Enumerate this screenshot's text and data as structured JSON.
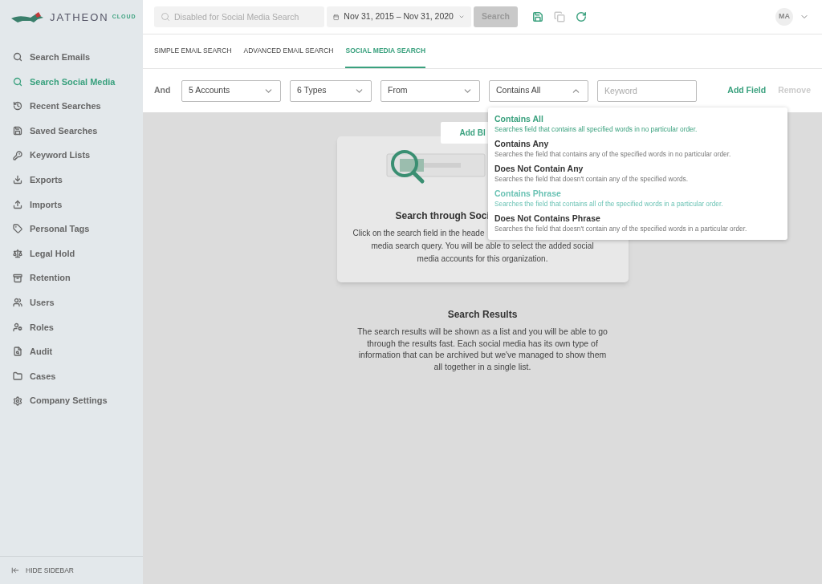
{
  "logo": {
    "name": "JATHEON",
    "suffix": "CLOUD"
  },
  "sidebar": {
    "items": [
      {
        "label": "Search Emails",
        "selected": false
      },
      {
        "label": "Search Social Media",
        "selected": true
      },
      {
        "label": "Recent Searches",
        "selected": false
      },
      {
        "label": "Saved Searches",
        "selected": false
      },
      {
        "label": "Keyword Lists",
        "selected": false
      },
      {
        "label": "Exports",
        "selected": false
      },
      {
        "label": "Imports",
        "selected": false
      },
      {
        "label": "Personal Tags",
        "selected": false
      },
      {
        "label": "Legal Hold",
        "selected": false
      },
      {
        "label": "Retention",
        "selected": false
      },
      {
        "label": "Users",
        "selected": false
      },
      {
        "label": "Roles",
        "selected": false
      },
      {
        "label": "Audit",
        "selected": false
      },
      {
        "label": "Cases",
        "selected": false
      },
      {
        "label": "Company Settings",
        "selected": false
      }
    ],
    "hide_sidebar": "HIDE SIDEBAR"
  },
  "header": {
    "search": {
      "placeholder": "Disabled for Social Media Search",
      "disabled": true
    },
    "date_range": "Nov 31, 2015 – Nov 31, 2020",
    "search_button": {
      "label": "Search",
      "disabled": true
    },
    "avatar": "MA"
  },
  "tabs": [
    {
      "label": "SIMPLE EMAIL SEARCH",
      "selected": false
    },
    {
      "label": "ADVANCED EMAIL SEARCH",
      "selected": false
    },
    {
      "label": "SOCIAL MEDIA SEARCH",
      "selected": true
    }
  ],
  "filter": {
    "operator": "And",
    "selects": [
      {
        "value": "5 Accounts",
        "open": false
      },
      {
        "value": "6 Types",
        "open": false
      },
      {
        "value": "From",
        "open": false
      },
      {
        "value": "Contains All",
        "open": true
      }
    ],
    "keyword": {
      "placeholder": "Keyword"
    },
    "add_field": {
      "label": "Add Field",
      "disabled": false
    },
    "remove": {
      "label": "Remove",
      "disabled": true
    }
  },
  "dropdown": [
    {
      "title": "Contains All",
      "description": "Searches field that contains all specified words in no particular order.",
      "selected": true,
      "hovered": false
    },
    {
      "title": "Contains Any",
      "description": "Searches the field that contains any of the specified words in no particular order.",
      "selected": false,
      "hovered": false
    },
    {
      "title": "Does Not Contain Any",
      "description": "Searches the field that doesn't contain any of the specified words.",
      "selected": false,
      "hovered": false
    },
    {
      "title": "Contains Phrase",
      "description": "Searches the field that contains all of the specified words in a particular order.",
      "selected": false,
      "hovered": true
    },
    {
      "title": "Does Not Contains Phrase",
      "description": "Searches the field that doesn't contain any of the specified words in a particular order.",
      "selected": false,
      "hovered": false
    }
  ],
  "card": {
    "add_button": "Add Bl",
    "title": "Search through Soci",
    "description_lines": [
      "Click on the search field in the heade",
      "media search query. You will be able to select the added social",
      "media accounts for this organization."
    ]
  },
  "results": {
    "title": "Search Results",
    "text": "The search results will be shown as a list and you will be able to go through the results fast. Each social media has its own type of information that can be archived but we've managed to show them all together in a single list."
  }
}
